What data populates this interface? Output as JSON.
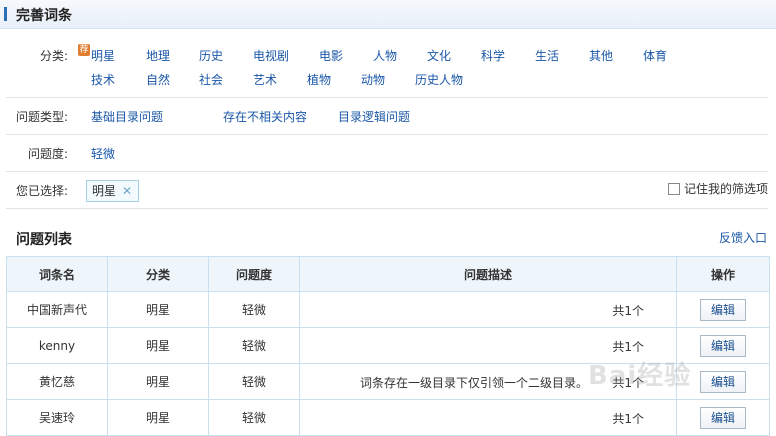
{
  "header": {
    "title": "完善词条"
  },
  "filters": {
    "category_label": "分类:",
    "recommend_badge": "荐",
    "categories_row1": [
      "明星",
      "地理",
      "历史",
      "电视剧",
      "电影",
      "人物",
      "文化",
      "科学",
      "生活",
      "其他",
      "体育"
    ],
    "categories_row2": [
      "技术",
      "自然",
      "社会",
      "艺术",
      "植物",
      "动物",
      "历史人物"
    ],
    "problem_type_label": "问题类型:",
    "problem_types": [
      "基础目录问题",
      "存在不相关内容",
      "目录逻辑问题"
    ],
    "severity_label": "问题度:",
    "severity_value": "轻微",
    "selected_label": "您已选择:",
    "selected_tag": "明星",
    "remember_label": "记住我的筛选项"
  },
  "list": {
    "title": "问题列表",
    "feedback_link": "反馈入口",
    "columns": [
      "词条名",
      "分类",
      "问题度",
      "问题描述",
      "操作"
    ],
    "rows": [
      {
        "name": "中国新声代",
        "category": "明星",
        "severity": "轻微",
        "description": "",
        "count": "共1个",
        "action": "编辑"
      },
      {
        "name": "kenny",
        "category": "明星",
        "severity": "轻微",
        "description": "",
        "count": "共1个",
        "action": "编辑"
      },
      {
        "name": "黄忆慈",
        "category": "明星",
        "severity": "轻微",
        "description": "词条存在一级目录下仅引领一个二级目录。",
        "count": "共1个",
        "action": "编辑"
      },
      {
        "name": "吴速玲",
        "category": "明星",
        "severity": "轻微",
        "description": "",
        "count": "共1个",
        "action": "编辑"
      }
    ]
  },
  "watermark": "Bai经验"
}
